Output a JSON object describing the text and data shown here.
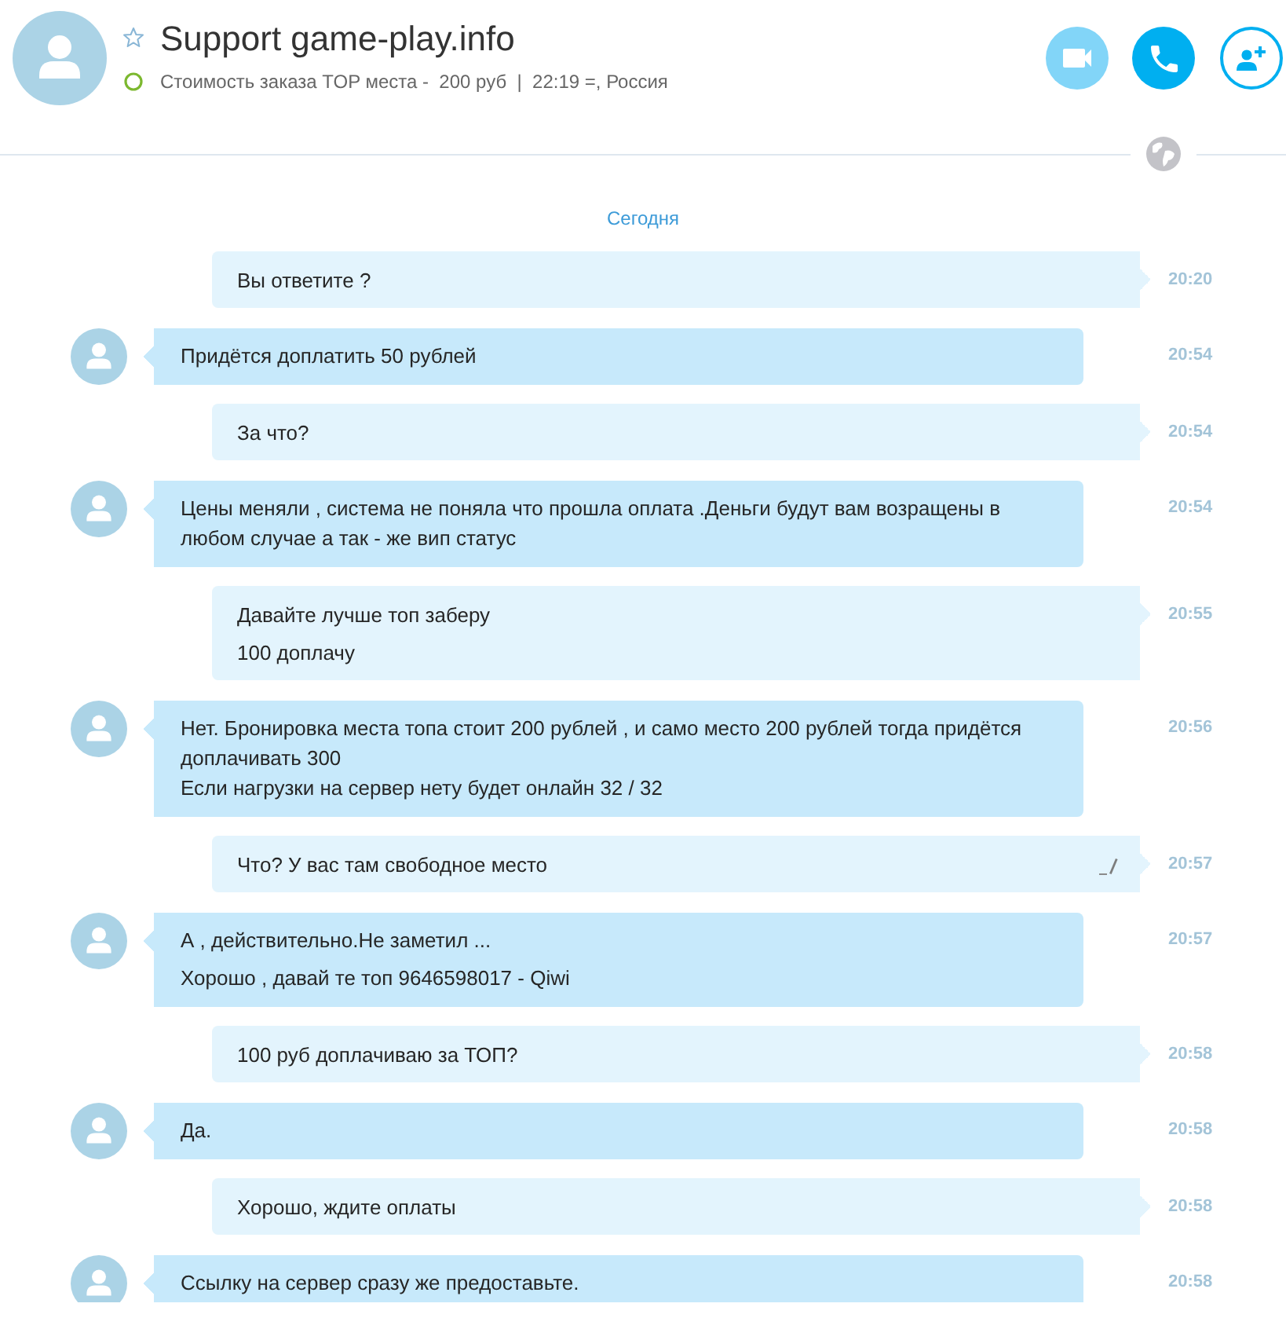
{
  "header": {
    "title": "Support game-play.info",
    "favorite": false,
    "online": true,
    "mood": "Стоимость заказа TOP места -  200 руб  |  22:19 =, Россия"
  },
  "date_separator": "Сегодня",
  "messages": [
    {
      "kind": "outgoing",
      "parts": [
        "Вы ответите ?"
      ],
      "time": "20:20",
      "edited": false
    },
    {
      "kind": "incoming",
      "parts": [
        "Придётся доплатить 50 рублей"
      ],
      "time": "20:54",
      "edited": false
    },
    {
      "kind": "outgoing",
      "parts": [
        "За что?"
      ],
      "time": "20:54",
      "edited": false
    },
    {
      "kind": "incoming",
      "parts": [
        "Цены меняли , система не поняла что прошла оплата .Деньги будут вам возращены в любом случае а так - же вип статус"
      ],
      "time": "20:54",
      "edited": false
    },
    {
      "kind": "outgoing",
      "parts": [
        "Давайте лучше топ заберу",
        "100 доплачу"
      ],
      "time": "20:55",
      "edited": false
    },
    {
      "kind": "incoming",
      "parts": [
        "Нет. Бронировка места топа стоит 200 рублей , и само место 200 рублей тогда придётся доплачивать 300\nЕсли нагрузки на сервер нету будет онлайн 32 / 32"
      ],
      "time": "20:56",
      "edited": false
    },
    {
      "kind": "outgoing",
      "parts": [
        "Что? У вас там свободное место"
      ],
      "time": "20:57",
      "edited": true
    },
    {
      "kind": "incoming",
      "parts": [
        "А , действительно.Не заметил ...",
        "Хорошо , давай те топ 9646598017 - Qiwi"
      ],
      "time": "20:57",
      "edited": false
    },
    {
      "kind": "outgoing",
      "parts": [
        "100 руб доплачиваю за ТОП?"
      ],
      "time": "20:58",
      "edited": false
    },
    {
      "kind": "incoming",
      "parts": [
        "Да."
      ],
      "time": "20:58",
      "edited": false
    },
    {
      "kind": "outgoing",
      "parts": [
        "Хорошо, ждите оплаты"
      ],
      "time": "20:58",
      "edited": false
    },
    {
      "kind": "incoming",
      "parts": [
        "Ссылку на сервер сразу же предоставьте."
      ],
      "time": "20:58",
      "edited": false
    }
  ]
}
